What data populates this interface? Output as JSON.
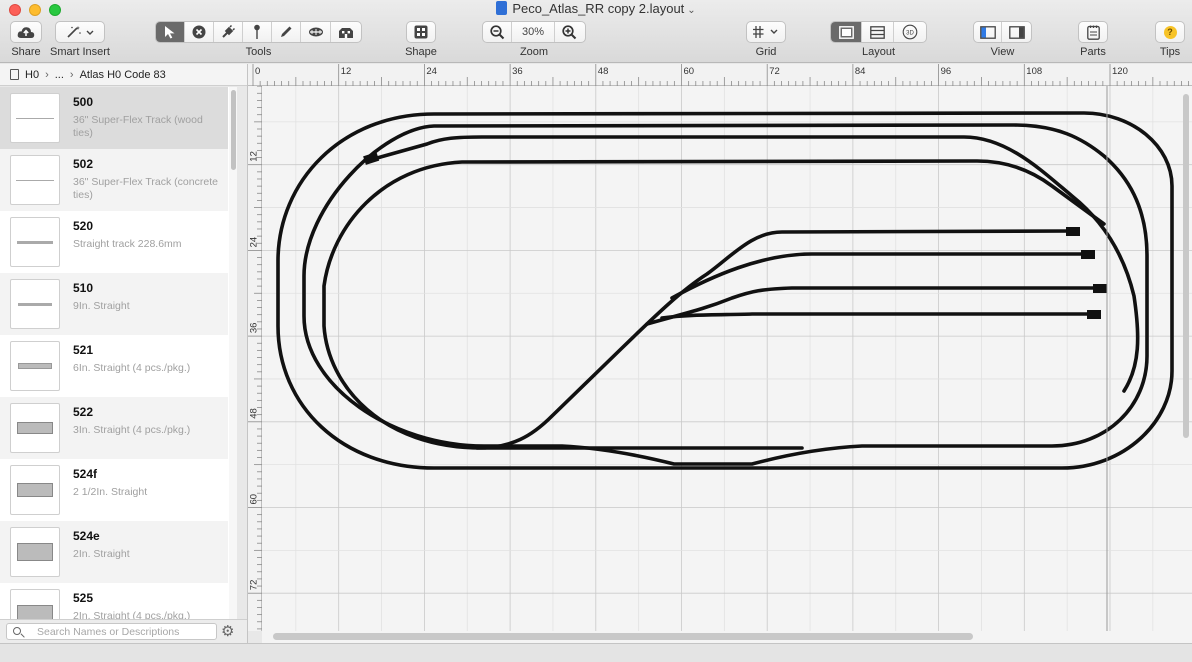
{
  "window": {
    "title": "Peco_Atlas_RR copy 2.layout"
  },
  "toolbar": {
    "share_label": "Share",
    "smart_insert_label": "Smart Insert",
    "tools_label": "Tools",
    "shape_label": "Shape",
    "zoom_label": "Zoom",
    "zoom_value": "30%",
    "grid_label": "Grid",
    "layout_label": "Layout",
    "view_label": "View",
    "parts_label": "Parts",
    "tips_label": "Tips",
    "tips_glyph": "?",
    "threed_glyph": "3D"
  },
  "breadcrumb": {
    "root": "H0",
    "ellipsis": "...",
    "current": "Atlas H0 Code 83"
  },
  "parts": [
    {
      "name": "500",
      "desc": "36\" Super-Flex Track (wood ties)"
    },
    {
      "name": "502",
      "desc": "36\" Super-Flex Track (concrete ties)"
    },
    {
      "name": "520",
      "desc": "Straight track 228.6mm"
    },
    {
      "name": "510",
      "desc": "9In. Straight"
    },
    {
      "name": "521",
      "desc": "6In. Straight (4 pcs./pkg.)"
    },
    {
      "name": "522",
      "desc": "3In. Straight (4 pcs./pkg.)"
    },
    {
      "name": "524f",
      "desc": "2 1/2In. Straight"
    },
    {
      "name": "524e",
      "desc": "2In. Straight"
    },
    {
      "name": "525",
      "desc": "2In. Straight (4 pcs./pkg.)"
    }
  ],
  "search": {
    "placeholder": "Search Names or Descriptions"
  },
  "ruler": {
    "top_labels": [
      "0",
      "12",
      "24",
      "36",
      "48",
      "60",
      "72",
      "84",
      "96",
      "108",
      "120"
    ],
    "left_labels": [
      "12",
      "24",
      "36",
      "48",
      "60",
      "72"
    ]
  },
  "colors": {
    "track": "#111111",
    "grid_major": "#c9c9c9",
    "grid_minor": "#e1e1e1",
    "canvas": "#f4f4f4"
  }
}
